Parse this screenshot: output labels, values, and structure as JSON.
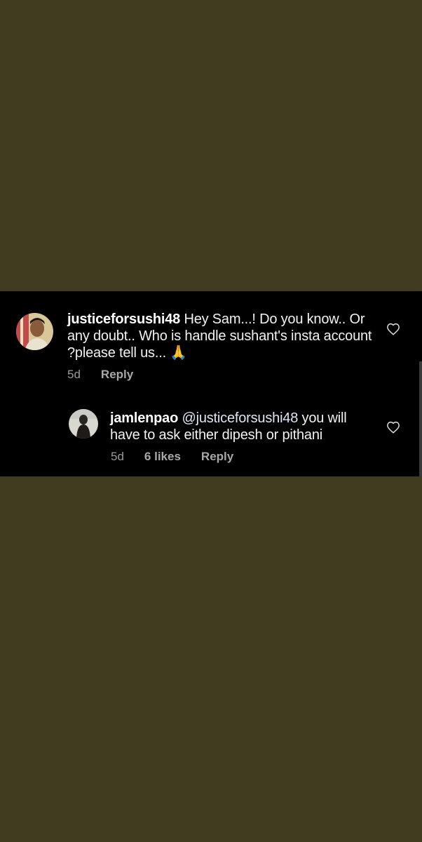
{
  "comment": {
    "username": "justiceforsushi48",
    "text": "Hey Sam...! Do you know.. Or any doubt.. Who is handle sushant's insta account ?please tell us... 🙏",
    "time": "5d",
    "reply_label": "Reply"
  },
  "reply": {
    "username": "jamlenpao",
    "mention": "@justiceforsushi48",
    "text": "you will have to ask either dipesh or pithani",
    "time": "5d",
    "likes": "6 likes",
    "reply_label": "Reply"
  },
  "colors": {
    "background": "#413b20",
    "panel": "#000000",
    "text": "#f2f2f2",
    "meta": "#9a9a9a",
    "mention": "#e0e6f5"
  },
  "icons": {
    "like": "heart-outline-icon"
  }
}
